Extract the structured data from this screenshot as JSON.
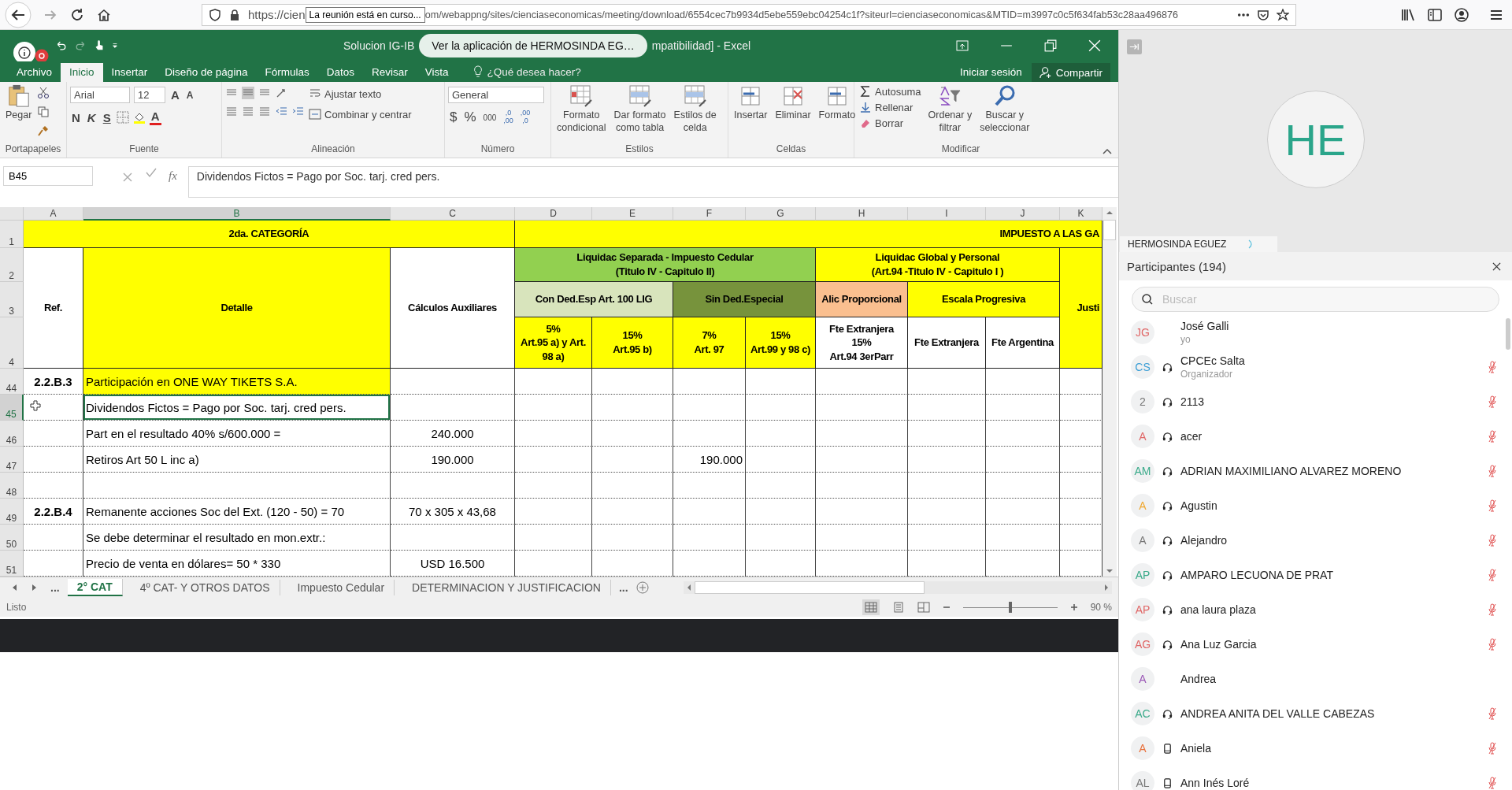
{
  "browser": {
    "url_start": "https://cien",
    "tooltip": "La reunión está en curso...",
    "url_rest": "om/webappng/sites/cienciaseconomicas/meeting/download/6554cec7b9934d5ebe559ebc04254c1f?siteurl=cienciaseconomicas&MTID=m3997c0c5f634fab53c28aa496876"
  },
  "excel": {
    "title_start": "Solucion  IG-IB",
    "toast": "Ver la aplicación de HERMOSINDA EG…",
    "title_end": "mpatibilidad] - Excel",
    "menu_tabs": [
      {
        "label": "Archivo",
        "selected": false
      },
      {
        "label": "Inicio",
        "selected": true
      },
      {
        "label": "Insertar",
        "selected": false
      },
      {
        "label": "Diseño de página",
        "selected": false
      },
      {
        "label": "Fórmulas",
        "selected": false
      },
      {
        "label": "Datos",
        "selected": false
      },
      {
        "label": "Revisar",
        "selected": false
      },
      {
        "label": "Vista",
        "selected": false
      }
    ],
    "tell_me": "¿Qué desea hacer?",
    "sign_in": "Iniciar sesión",
    "share": "Compartir",
    "ribbon": {
      "clipboard": {
        "paste": "Pegar",
        "label": "Portapapeles"
      },
      "font": {
        "family": "Arial",
        "size": "12",
        "grow": "A",
        "shrink": "A",
        "styles": [
          "N",
          "K",
          "S"
        ],
        "color_button": "A",
        "label": "Fuente"
      },
      "alignment": {
        "wrap": "Ajustar texto",
        "merge": "Combinar y centrar",
        "label": "Alineación"
      },
      "number": {
        "format": "General",
        "currency": "$",
        "percent": "%",
        "thousands": "000",
        "decimals": [
          {
            "top": ",0",
            "bottom": ",00"
          },
          {
            "top": ",00",
            "bottom": ",0"
          }
        ],
        "label": "Número"
      },
      "styles": {
        "buttons": [
          "Formato\ncondicional",
          "Dar formato\ncomo tabla",
          "Estilos de\ncelda"
        ],
        "label": "Estilos"
      },
      "cells": {
        "buttons": [
          "Insertar",
          "Eliminar",
          "Formato"
        ],
        "label": "Celdas"
      },
      "editing": {
        "small": [
          "Autosuma",
          "Rellenar",
          "Borrar"
        ],
        "buttons": [
          "Ordenar y\nfiltrar",
          "Buscar y\nseleccionar"
        ],
        "label": "Modificar"
      }
    },
    "formula_bar": {
      "name_box": "B45",
      "fx": "fx",
      "formula": "Dividendos Fictos = Pago por Soc. tarj. cred pers."
    },
    "sheet": {
      "columns": [
        "A",
        "B",
        "C",
        "D",
        "E",
        "F",
        "G",
        "H",
        "I",
        "J",
        "K"
      ],
      "rows": [
        "1",
        "2",
        "3",
        "4",
        "44",
        "45",
        "46",
        "47",
        "48",
        "49",
        "50",
        "51"
      ],
      "cells": [
        {
          "text": "2da. CATEGORÍA",
          "color": "#ffff00",
          "bold": true,
          "selected": false
        },
        {
          "text": "IMPUESTO A LAS GA",
          "color": "#ffff00",
          "bold": true,
          "selected": false
        },
        {
          "text": "Ref.",
          "color": "#ffffff",
          "bold": true,
          "selected": false
        },
        {
          "text": "Detalle",
          "color": "#ffff00",
          "bold": true,
          "selected": false
        },
        {
          "text": "Cálculos Auxiliares",
          "color": "#ffffff",
          "bold": true,
          "selected": false
        },
        {
          "text": "Liquidac Separada - Impuesto Cedular\n(Titulo IV - Capitulo II)",
          "color": "#92d050",
          "bold": true,
          "selected": false
        },
        {
          "text": "Liquidac Global y Personal\n(Art.94 -Titulo IV - Capitulo I )",
          "color": "#ffff00",
          "bold": true,
          "selected": false
        },
        {
          "text": "Justi",
          "color": "#ffff00",
          "bold": true,
          "selected": false
        },
        {
          "text": "Con Ded.Esp Art. 100 LIG",
          "color": "#d8e4bc",
          "bold": true,
          "selected": false
        },
        {
          "text": "Sin Ded.Especial",
          "color": "#77933c",
          "bold": true,
          "selected": false
        },
        {
          "text": "Alic Proporcional",
          "color": "#fabf8f",
          "bold": true,
          "selected": false
        },
        {
          "text": "Escala Progresiva",
          "color": "#ffff00",
          "bold": true,
          "selected": false
        },
        {
          "text": "5%\nArt.95 a) y Art.\n98 a)",
          "color": "#ffff00",
          "bold": true,
          "selected": false
        },
        {
          "text": "15%\nArt.95 b)",
          "color": "#ffff00",
          "bold": true,
          "selected": false
        },
        {
          "text": "7%\nArt. 97",
          "color": "#ffff00",
          "bold": true,
          "selected": false
        },
        {
          "text": "15%\nArt.99 y 98 c)",
          "color": "#ffff00",
          "bold": true,
          "selected": false
        },
        {
          "text": "Fte Extranjera\n15%\nArt.94 3erParr",
          "color": "#ffffff",
          "bold": true,
          "selected": false
        },
        {
          "text": "Fte Extranjera",
          "color": "#ffffff",
          "bold": true,
          "selected": false
        },
        {
          "text": "Fte Argentina",
          "color": "#ffffff",
          "bold": true,
          "selected": false
        },
        {
          "text": "2.2.B.3",
          "color": "#ffffff",
          "bold": true,
          "selected": false
        },
        {
          "text": "Participación en ONE WAY TIKETS S.A.",
          "color": "#ffff00",
          "bold": false,
          "selected": false
        },
        {
          "text": "Dividendos Fictos = Pago por Soc. tarj. cred pers.",
          "color": "#ffffff",
          "bold": false,
          "selected": true
        },
        {
          "text": "Part en el resultado 40% s/600.000 =",
          "color": "#ffffff",
          "bold": false,
          "selected": false
        },
        {
          "text": "240.000",
          "color": "#ffffff",
          "bold": false,
          "selected": false
        },
        {
          "text": "Retiros Art 50 L inc a)",
          "color": "#ffffff",
          "bold": false,
          "selected": false
        },
        {
          "text": "190.000",
          "color": "#ffffff",
          "bold": false,
          "selected": false
        },
        {
          "text": "190.000",
          "color": "#ffffff",
          "bold": false,
          "selected": false
        },
        {
          "text": "2.2.B.4",
          "color": "#ffffff",
          "bold": true,
          "selected": false
        },
        {
          "text": "Remanente acciones Soc del Ext. (120 - 50) = 70",
          "color": "#ffffff",
          "bold": false,
          "selected": false
        },
        {
          "text": "70 x 305 x 43,68",
          "color": "#ffffff",
          "bold": false,
          "selected": false
        },
        {
          "text": "Se debe determinar el resultado en mon.extr.:",
          "color": "#ffffff",
          "bold": false,
          "selected": false
        },
        {
          "text": "Precio de venta en dólares= 50 * 330",
          "color": "#ffffff",
          "bold": false,
          "selected": false
        },
        {
          "text": "USD 16.500",
          "color": "#ffffff",
          "bold": false,
          "selected": false
        }
      ]
    },
    "more_tabs_left": "...",
    "more_tabs_right": "...",
    "sheet_tabs": [
      {
        "label": "2° CAT",
        "selected": true
      },
      {
        "label": "4º CAT- Y OTROS DATOS",
        "selected": false
      },
      {
        "label": "Impuesto Cedular",
        "selected": false
      },
      {
        "label": "DETERMINACION Y JUSTIFICACION",
        "selected": false
      }
    ],
    "status": "Listo",
    "zoom": {
      "level": 0.5,
      "reading": "90 %"
    }
  },
  "meeting": {
    "video": {
      "initials": "HE",
      "name": "HERMOSINDA EGUEZ"
    },
    "title": "Participantes (194)",
    "search_placeholder": "Buscar",
    "participants": [
      {
        "initials": "JG",
        "color": "#e06666",
        "name": "José Galli",
        "role": "yo",
        "kind": "none",
        "muted": false
      },
      {
        "initials": "CS",
        "color": "#3d9fd6",
        "name": "CPCEc Salta",
        "role": "Organizador",
        "kind": "headset",
        "muted": true
      },
      {
        "initials": "2",
        "color": "#777777",
        "name": "2113",
        "kind": "headset",
        "muted": true
      },
      {
        "initials": "A",
        "color": "#e06666",
        "name": "acer",
        "kind": "headset",
        "muted": true
      },
      {
        "initials": "AM",
        "color": "#3aaa8a",
        "name": "ADRIAN MAXIMILIANO ALVAREZ MORENO",
        "kind": "headset",
        "muted": true
      },
      {
        "initials": "A",
        "color": "#f0a830",
        "name": "Agustin",
        "kind": "headset",
        "muted": true
      },
      {
        "initials": "A",
        "color": "#777777",
        "name": "Alejandro",
        "kind": "headset",
        "muted": true
      },
      {
        "initials": "AP",
        "color": "#3aaa8a",
        "name": "AMPARO LECUONA DE PRAT",
        "kind": "headset",
        "muted": true
      },
      {
        "initials": "AP",
        "color": "#e06666",
        "name": "ana laura plaza",
        "kind": "headset",
        "muted": true
      },
      {
        "initials": "AG",
        "color": "#e06666",
        "name": "Ana Luz Garcia",
        "kind": "headset",
        "muted": true
      },
      {
        "initials": "A",
        "color": "#9b59b6",
        "name": "Andrea",
        "kind": "none",
        "muted": false
      },
      {
        "initials": "AC",
        "color": "#3aaa8a",
        "name": "ANDREA ANITA DEL VALLE CABEZAS",
        "kind": "headset",
        "muted": true
      },
      {
        "initials": "A",
        "color": "#e8703a",
        "name": "Aniela",
        "kind": "phone",
        "muted": true
      },
      {
        "initials": "AL",
        "color": "#777777",
        "name": "Ann Inés Loré",
        "kind": "phone",
        "muted": true
      }
    ]
  }
}
